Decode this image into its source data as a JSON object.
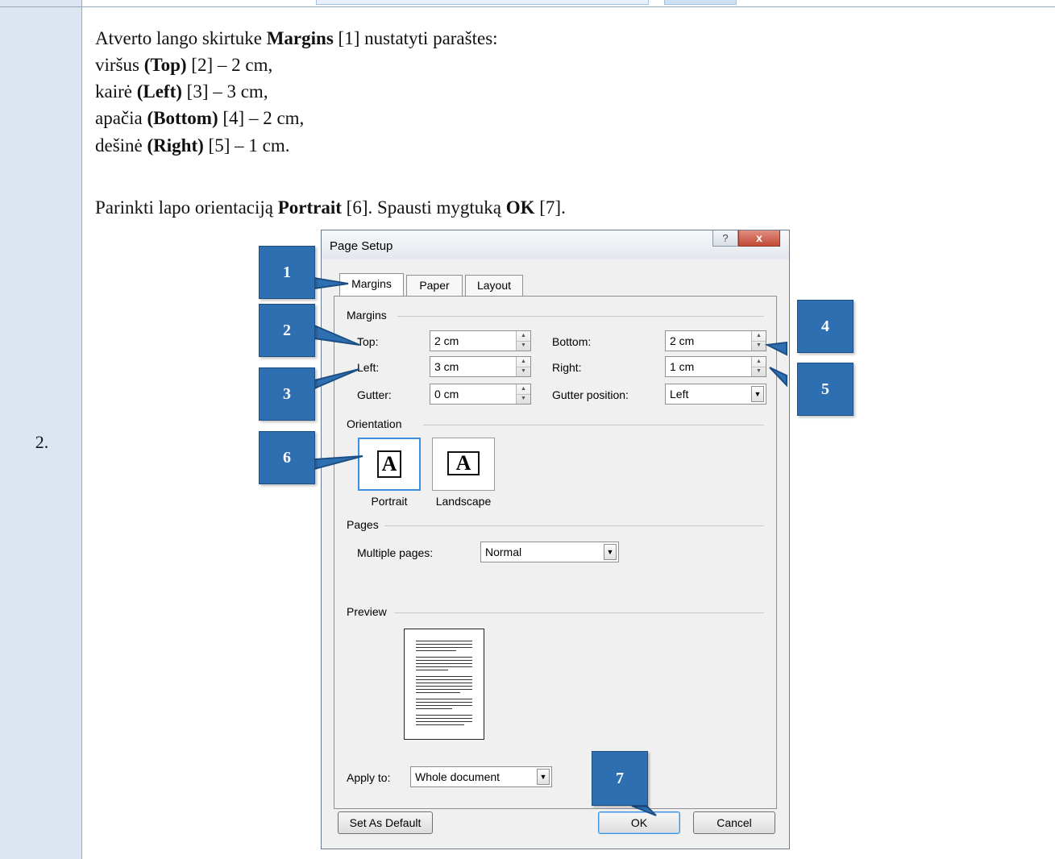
{
  "table": {
    "step_number": "2."
  },
  "instructions": {
    "line1": [
      "Atverto lango skirtuke ",
      "Margins",
      " [1] nustatyti paraštes:"
    ],
    "line2": [
      "viršus ",
      "(Top)",
      " [2] – 2 cm,"
    ],
    "line3": [
      "kairė ",
      "(Left)",
      " [3] – 3 cm,"
    ],
    "line4": [
      "apačia ",
      "(Bottom)",
      " [4] – 2 cm,"
    ],
    "line5": [
      "dešinė ",
      "(Right)",
      " [5] – 1 cm."
    ],
    "line6": [
      "Parinkti lapo orientaciją ",
      "Portrait",
      " [6]. Spausti mygtuką ",
      "OK",
      " [7]."
    ]
  },
  "dialog": {
    "title": "Page Setup",
    "help_glyph": "?",
    "close_glyph": "x",
    "tabs": [
      "Margins",
      "Paper",
      "Layout"
    ],
    "active_tab": "Margins",
    "margins_group": {
      "label": "Margins",
      "top": {
        "label": "Top:",
        "value": "2 cm"
      },
      "bottom": {
        "label": "Bottom:",
        "value": "2 cm"
      },
      "left": {
        "label": "Left:",
        "value": "3 cm"
      },
      "right": {
        "label": "Right:",
        "value": "1 cm"
      },
      "gutter": {
        "label": "Gutter:",
        "value": "0 cm"
      },
      "gutter_position": {
        "label": "Gutter position:",
        "value": "Left"
      }
    },
    "orientation_group": {
      "label": "Orientation",
      "portrait_label": "Portrait",
      "landscape_label": "Landscape",
      "glyph": "A",
      "selected": "Portrait"
    },
    "pages_group": {
      "label": "Pages",
      "multiple_pages_label": "Multiple pages:",
      "multiple_pages_value": "Normal"
    },
    "preview_group": {
      "label": "Preview"
    },
    "apply_to": {
      "label": "Apply to:",
      "value": "Whole document"
    },
    "buttons": {
      "set_as_default": "Set As Default",
      "ok": "OK",
      "cancel": "Cancel"
    }
  },
  "callouts": [
    "1",
    "2",
    "3",
    "4",
    "5",
    "6",
    "7"
  ],
  "colors": {
    "callout_blue": "#2e6fb2",
    "left_column": "#dce6f2",
    "close_red": "#c24a36",
    "selected_border": "#3c8fe0"
  }
}
